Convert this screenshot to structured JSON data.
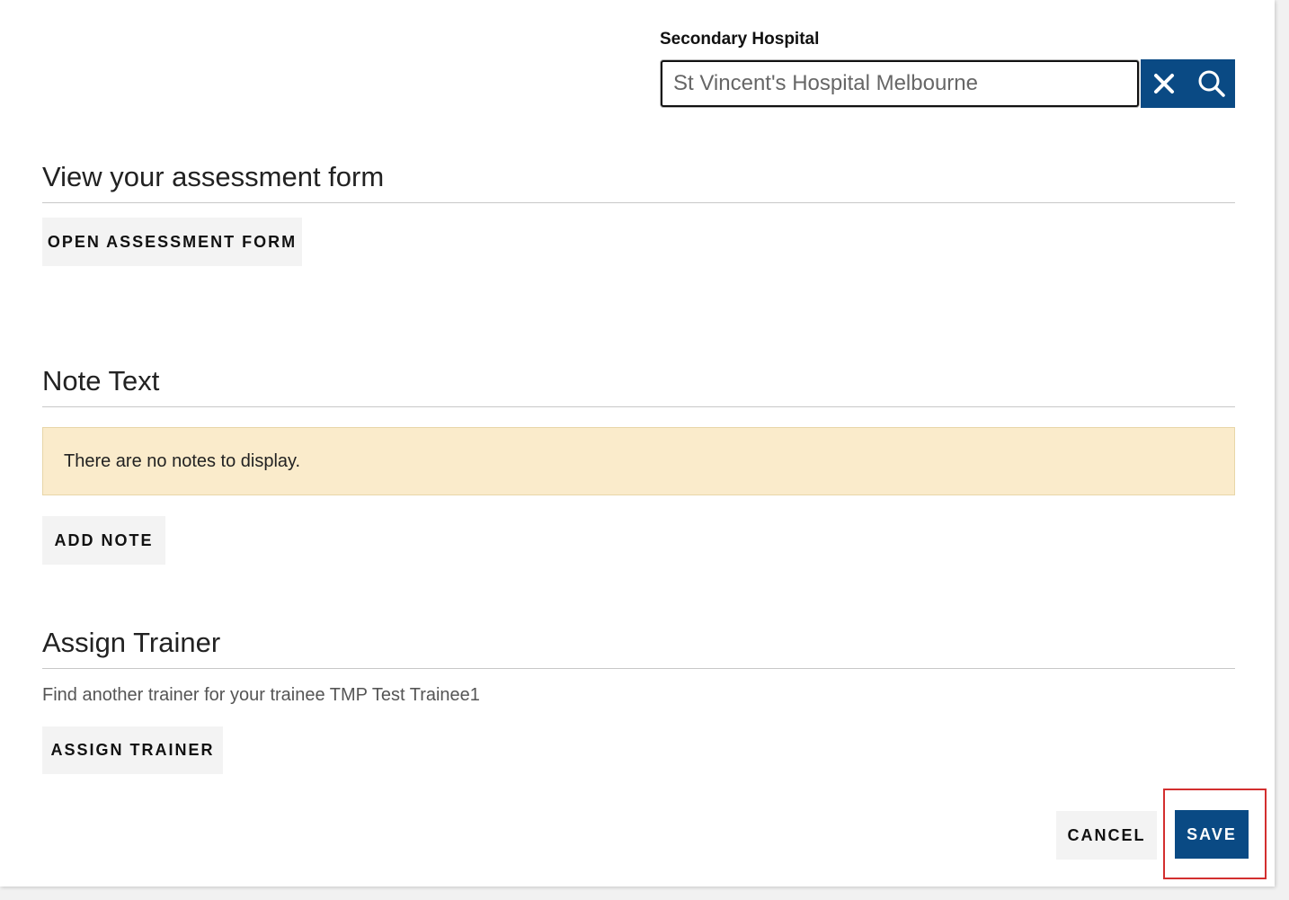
{
  "secondary_hospital": {
    "label": "Secondary Hospital",
    "value": "St Vincent's Hospital Melbourne",
    "clear_icon": "close-icon",
    "search_icon": "search-icon"
  },
  "assessment": {
    "title": "View your assessment form",
    "button_label": "OPEN ASSESSMENT FORM"
  },
  "notes": {
    "title": "Note Text",
    "empty_message": "There are no notes to display.",
    "add_button_label": "ADD NOTE"
  },
  "assign_trainer": {
    "title": "Assign Trainer",
    "description": "Find another trainer for your trainee TMP Test Trainee1",
    "button_label": "ASSIGN TRAINER"
  },
  "footer": {
    "cancel_label": "CANCEL",
    "save_label": "SAVE"
  },
  "colors": {
    "primary": "#0a4a84",
    "notice_bg": "#faebcb",
    "highlight": "#d32f2f"
  }
}
